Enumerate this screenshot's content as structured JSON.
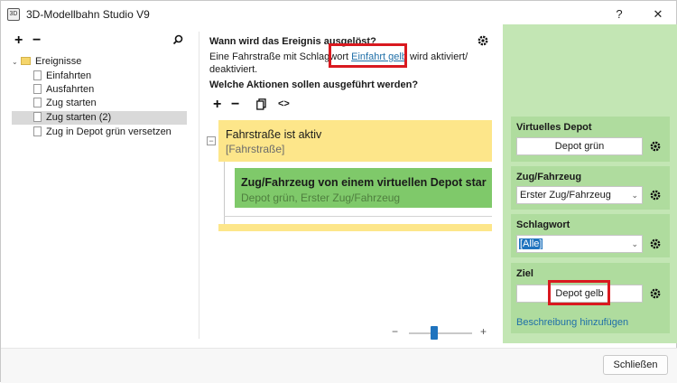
{
  "window": {
    "title": "3D-Modellbahn Studio V9",
    "help_label": "?",
    "close_label": "✕"
  },
  "sidebar": {
    "add_label": "+",
    "remove_label": "−",
    "search_icon": "search-icon",
    "tree": {
      "root": "Ereignisse",
      "items": [
        "Einfahrten",
        "Ausfahrten",
        "Zug starten",
        "Zug starten (2)",
        "Zug in Depot grün versetzen"
      ],
      "selected_index": 3
    }
  },
  "main": {
    "when_heading": "Wann wird das Ereignis ausgelöst?",
    "when_text_pre": "Eine Fahrstraße mit Schlagwort ",
    "when_link": "Einfahrt gelb",
    "when_text_post": " wird aktiviert/",
    "when_text_line2": "deaktiviert.",
    "actions_heading": "Welche Aktionen sollen ausgeführt werden?",
    "toolbar": {
      "add": "+",
      "remove": "−",
      "copy_icon": "copy-icon",
      "code": "<>"
    },
    "trigger_card": {
      "title": "Fahrstraße ist aktiv",
      "subtitle": "[Fahrstraße]"
    },
    "action_card": {
      "title": "Zug/Fahrzeug von einem virtuellen Depot star",
      "subtitle": "Depot grün, Erster Zug/Fahrzeug"
    },
    "zoom": {
      "minus": "−",
      "plus": "+",
      "level": 0.5
    }
  },
  "properties": {
    "depot": {
      "title": "Virtuelles Depot",
      "value": "Depot grün"
    },
    "vehicle": {
      "title": "Zug/Fahrzeug",
      "value": "Erster Zug/Fahrzeug"
    },
    "tag": {
      "title": "Schlagwort",
      "value": "[Alle]"
    },
    "target": {
      "title": "Ziel",
      "value": "Depot gelb"
    },
    "add_description": "Beschreibung hinzufügen"
  },
  "footer": {
    "close_button": "Schließen"
  },
  "colors": {
    "trigger_card": "#fde68a",
    "action_card": "#7fc96a",
    "panel": "#c3e6b4",
    "highlight": "#d9191f",
    "link": "#1f6fa8"
  }
}
